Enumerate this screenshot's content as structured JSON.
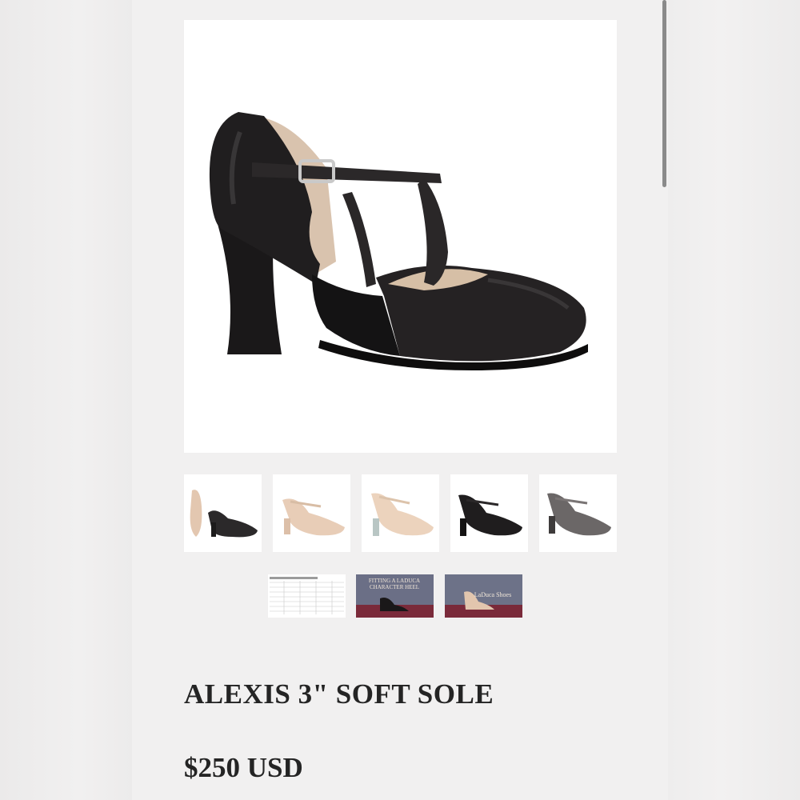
{
  "product": {
    "title": "ALEXIS 3\" SOFT SOLE",
    "price": "$250 USD"
  },
  "main_image": {
    "alt": "black leather t-strap character heel",
    "color": "#1c1a1b"
  },
  "thumbnails": [
    {
      "name": "thumb-pair",
      "color": "#e8cdb8"
    },
    {
      "name": "thumb-tan",
      "color": "#e9cfb9"
    },
    {
      "name": "thumb-tan-clear",
      "color": "#ecd5c0"
    },
    {
      "name": "thumb-black",
      "color": "#1e1c1d"
    },
    {
      "name": "thumb-grey",
      "color": "#6e6a6a"
    }
  ],
  "media_thumbnails": [
    {
      "name": "size-chart-thumb",
      "text": ""
    },
    {
      "name": "video-fitting-thumb",
      "text": "FITTING A LADUCA CHARACTER HEEL"
    },
    {
      "name": "video-laduca-thumb",
      "text": "LaDuca Shoes"
    }
  ]
}
